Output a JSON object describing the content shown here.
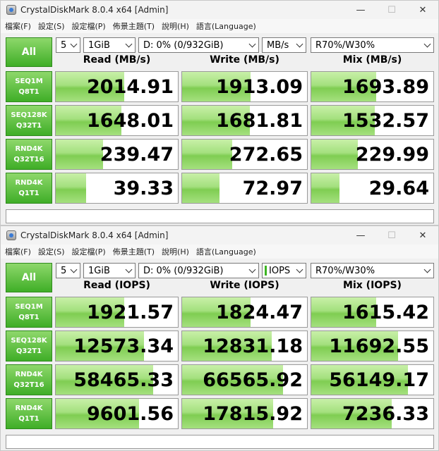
{
  "windows": [
    {
      "title": "CrystalDiskMark 8.0.4 x64 [Admin]",
      "window_controls": {
        "minimize": "—",
        "maximize": "☐",
        "close": "✕"
      },
      "menu": [
        "檔案(F)",
        "設定(S)",
        "設定檔(P)",
        "佈景主題(T)",
        "說明(H)",
        "語言(Language)"
      ],
      "all_button": "All",
      "controls": {
        "count": "5",
        "size": "1GiB",
        "drive": "D: 0% (0/932GiB)",
        "unit": "MB/s",
        "profile": "R70%/W30%"
      },
      "headers": {
        "read": "Read (MB/s)",
        "write": "Write (MB/s)",
        "mix": "Mix (MB/s)"
      },
      "rows": [
        {
          "line1": "SEQ1M",
          "line2": "Q8T1",
          "read": "2014.91",
          "write": "1913.09",
          "mix": "1693.89",
          "fill_pct": {
            "read": 56,
            "write": 55,
            "mix": 53
          }
        },
        {
          "line1": "SEQ128K",
          "line2": "Q32T1",
          "read": "1648.01",
          "write": "1681.81",
          "mix": "1532.57",
          "fill_pct": {
            "read": 54,
            "write": 54,
            "mix": 52
          }
        },
        {
          "line1": "RND4K",
          "line2": "Q32T16",
          "read": "239.47",
          "write": "272.65",
          "mix": "229.99",
          "fill_pct": {
            "read": 39,
            "write": 40,
            "mix": 38
          }
        },
        {
          "line1": "RND4K",
          "line2": "Q1T1",
          "read": "39.33",
          "write": "72.97",
          "mix": "29.64",
          "fill_pct": {
            "read": 25,
            "write": 30,
            "mix": 23
          }
        }
      ],
      "comment": ""
    },
    {
      "title": "CrystalDiskMark 8.0.4 x64 [Admin]",
      "window_controls": {
        "minimize": "—",
        "maximize": "☐",
        "close": "✕"
      },
      "menu": [
        "檔案(F)",
        "設定(S)",
        "設定檔(P)",
        "佈景主題(T)",
        "說明(H)",
        "語言(Language)"
      ],
      "all_button": "All",
      "controls": {
        "count": "5",
        "size": "1GiB",
        "drive": "D: 0% (0/932GiB)",
        "unit": "IOPS",
        "profile": "R70%/W30%"
      },
      "headers": {
        "read": "Read (IOPS)",
        "write": "Write (IOPS)",
        "mix": "Mix (IOPS)"
      },
      "rows": [
        {
          "line1": "SEQ1M",
          "line2": "Q8T1",
          "read": "1921.57",
          "write": "1824.47",
          "mix": "1615.42",
          "fill_pct": {
            "read": 56,
            "write": 55,
            "mix": 53
          }
        },
        {
          "line1": "SEQ128K",
          "line2": "Q32T1",
          "read": "12573.34",
          "write": "12831.18",
          "mix": "11692.55",
          "fill_pct": {
            "read": 72,
            "write": 72,
            "mix": 71
          }
        },
        {
          "line1": "RND4K",
          "line2": "Q32T16",
          "read": "58465.33",
          "write": "66565.92",
          "mix": "56149.17",
          "fill_pct": {
            "read": 80,
            "write": 81,
            "mix": 79
          }
        },
        {
          "line1": "RND4K",
          "line2": "Q1T1",
          "read": "9601.56",
          "write": "17815.92",
          "mix": "7236.33",
          "fill_pct": {
            "read": 68,
            "write": 73,
            "mix": 66
          }
        }
      ],
      "comment": ""
    }
  ],
  "colors": {
    "accent_green": "#3fae27",
    "bar_green": "#7fcd52"
  }
}
